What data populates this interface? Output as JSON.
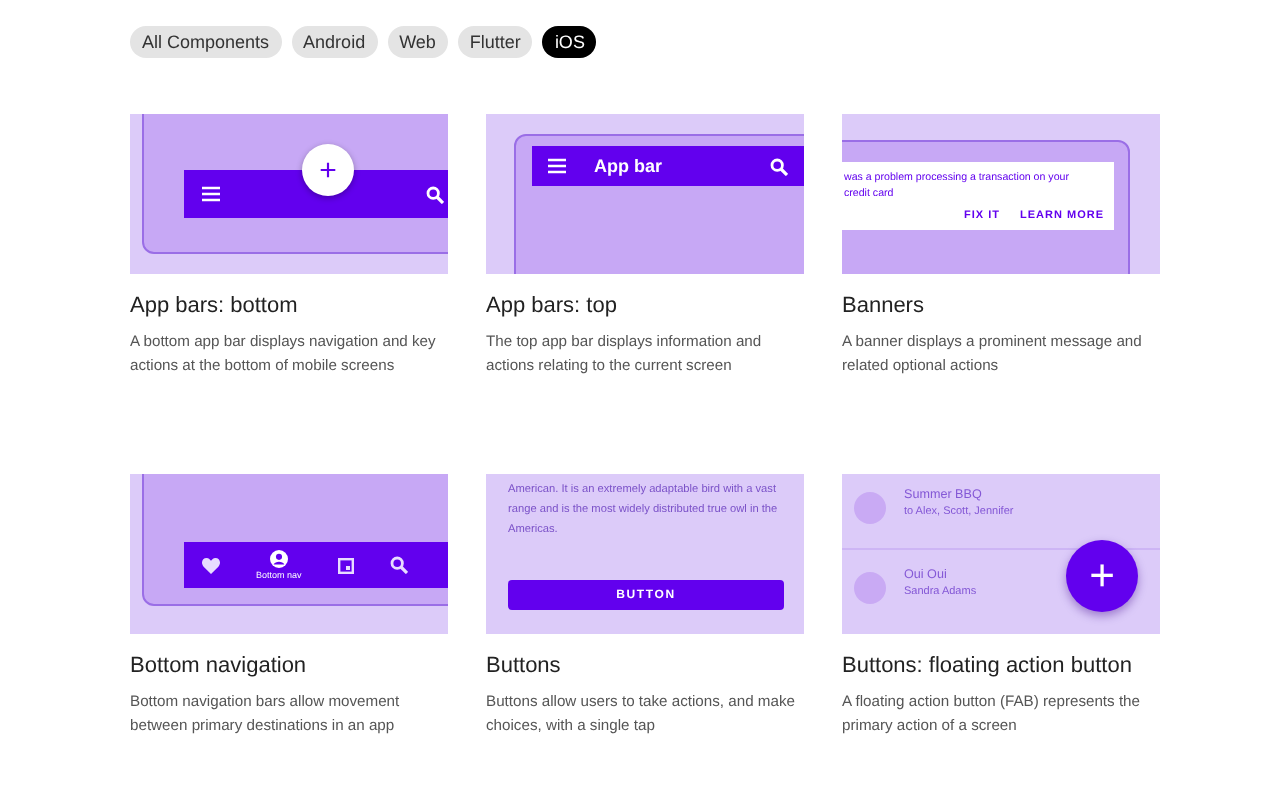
{
  "filters": [
    {
      "label": "All Components",
      "selected": false
    },
    {
      "label": "Android",
      "selected": false
    },
    {
      "label": "Web",
      "selected": false
    },
    {
      "label": "Flutter",
      "selected": false
    },
    {
      "label": "iOS",
      "selected": true
    }
  ],
  "cards": [
    {
      "kind": "bottom-app-bar",
      "title": "App bars: bottom",
      "description": "A bottom app bar displays navigation and key actions at the bottom of mobile screens",
      "preview": {
        "fab_label": "+"
      }
    },
    {
      "kind": "top-app-bar",
      "title": "App bars: top",
      "description": "The top app bar displays information and actions relating to the current screen",
      "preview": {
        "bar_title": "App bar"
      }
    },
    {
      "kind": "banner",
      "title": "Banners",
      "description": "A banner displays a prominent message and related optional actions",
      "preview": {
        "message": "was a problem processing a transaction on your credit card",
        "actions": [
          "FIX IT",
          "LEARN MORE"
        ]
      }
    },
    {
      "kind": "bottom-navigation",
      "title": "Bottom navigation",
      "description": "Bottom navigation bars allow movement between primary destinations in an app",
      "preview": {
        "active_label": "Bottom nav"
      }
    },
    {
      "kind": "buttons",
      "title": "Buttons",
      "description": "Buttons allow users to take actions, and make choices, with a single tap",
      "preview": {
        "text": "American. It is an extremely adaptable bird with a vast range and is the most widely distributed true owl in the Americas.",
        "button": "BUTTON"
      }
    },
    {
      "kind": "fab",
      "title": "Buttons: floating action button",
      "description": "A floating action button (FAB) represents the primary action of a screen",
      "preview": {
        "items": [
          {
            "title": "Summer BBQ",
            "subtitle": "to Alex, Scott, Jennifer"
          },
          {
            "title": "Oui Oui",
            "subtitle": "Sandra Adams"
          }
        ],
        "fab_label": "+"
      }
    }
  ]
}
